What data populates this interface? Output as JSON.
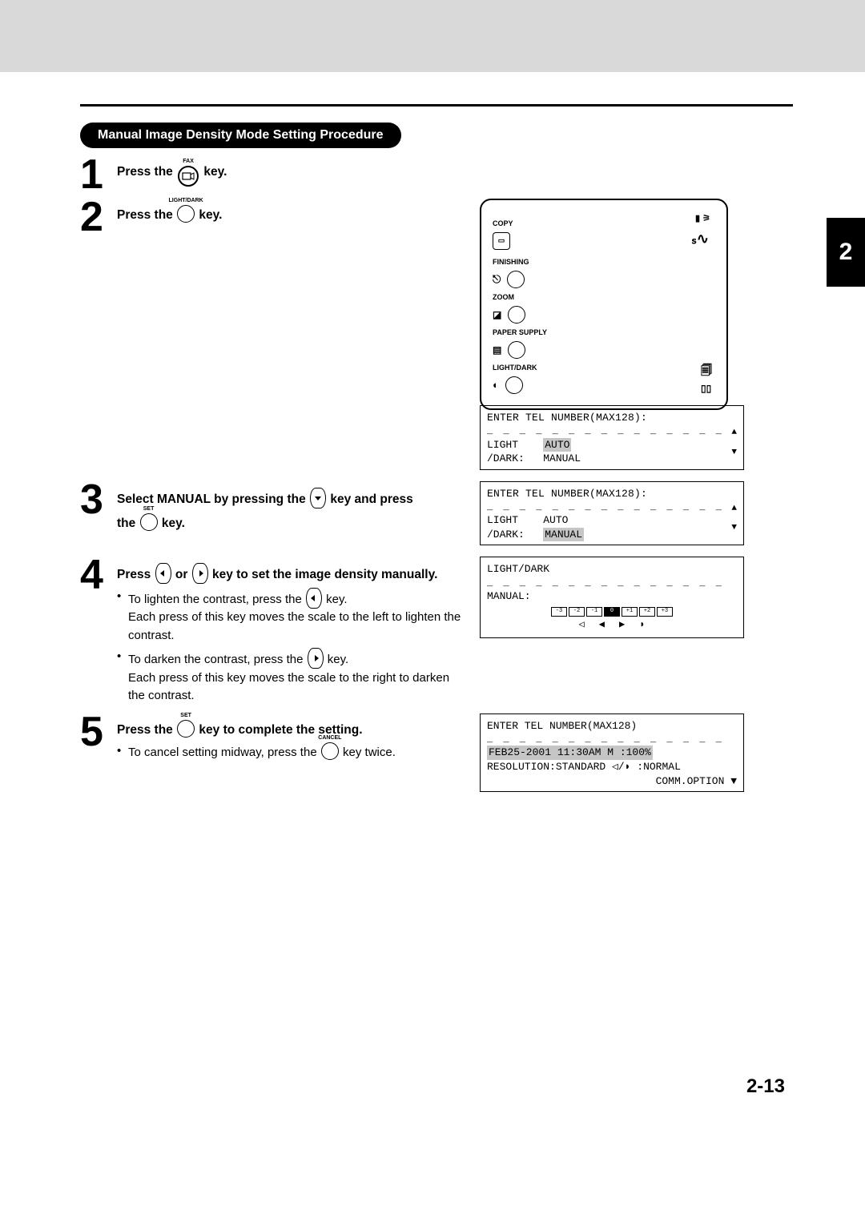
{
  "chapter_tab": "2",
  "page_number": "2-13",
  "procedure_title": "Manual Image Density Mode Setting Procedure",
  "steps": {
    "s1": {
      "num": "1",
      "text_a": "Press the ",
      "key_label": "FAX",
      "text_b": " key."
    },
    "s2": {
      "num": "2",
      "text_a": "Press the ",
      "key_label": "LIGHT/DARK",
      "text_b": " key."
    },
    "s3": {
      "num": "3",
      "line1_a": "Select MANUAL by pressing the ",
      "line1_b": " key and press",
      "line2_a": "the ",
      "line2_b": " key.",
      "set_label": "SET"
    },
    "s4": {
      "num": "4",
      "head_a": "Press ",
      "head_b": " or ",
      "head_c": " key to set the image density manually.",
      "bul1_a": "To lighten the contrast, press the ",
      "bul1_b": " key.",
      "bul1_detail": "Each press of this key moves the scale to the left to lighten the contrast.",
      "bul2_a": "To darken the contrast, press the ",
      "bul2_b": " key.",
      "bul2_detail": "Each press of this key moves the scale to the right to darken the contrast."
    },
    "s5": {
      "num": "5",
      "head_a": "Press the ",
      "head_b": " key to complete the setting.",
      "set_label": "SET",
      "bul_a": "To cancel setting midway, press the ",
      "bul_b": " key twice.",
      "cancel_label": "CANCEL"
    }
  },
  "panel": {
    "copy": "COPY",
    "finishing": "FINISHING",
    "zoom": "ZOOM",
    "paper_supply": "PAPER SUPPLY",
    "light_dark": "LIGHT/DARK"
  },
  "lcd": {
    "box1": {
      "l1": "ENTER TEL NUMBER(MAX128):",
      "l2a": "LIGHT",
      "l2b": "AUTO",
      "l3a": "/DARK:",
      "l3b": "MANUAL"
    },
    "box2": {
      "l1": "ENTER TEL NUMBER(MAX128):",
      "l2a": "LIGHT",
      "l2b": "AUTO",
      "l3a": "/DARK:",
      "l3b": "MANUAL"
    },
    "box3": {
      "l1": "LIGHT/DARK",
      "l2": "MANUAL:",
      "scale": [
        "-3",
        "-2",
        "-1",
        "0",
        "+1",
        "+2",
        "+3"
      ]
    },
    "box4": {
      "l1": "ENTER TEL NUMBER(MAX128)",
      "l2": "FEB25-2001 11:30AM  M  :100%",
      "l3a": "RESOLUTION:STANDARD",
      "l3b": ":NORMAL",
      "l4": "COMM.OPTION"
    }
  }
}
